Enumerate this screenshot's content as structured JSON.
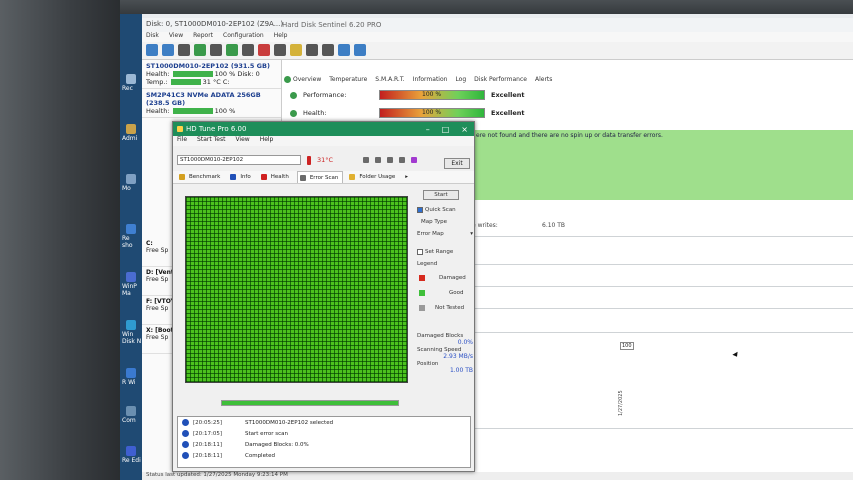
{
  "hds": {
    "title": "Disk: 0, ST1000DM010-2EP102 (Z9A...)",
    "title_center": "Hard Disk Sentinel 6.20 PRO",
    "menu": [
      "Disk",
      "View",
      "Report",
      "Configuration",
      "Help"
    ],
    "disks": [
      {
        "name": "ST1000DM010-2EP102 (931.5 GB)",
        "health_label": "Health:",
        "health": "100 %",
        "disk_label": "Disk: 0",
        "temp_label": "Temp.:",
        "temp": "31 °C",
        "temp_suffix": "C:"
      },
      {
        "name": "SM2P41C3 NVMe ADATA 256GB (238.5 GB)",
        "health_label": "Health:",
        "health": "100 %"
      }
    ],
    "volumes": [
      {
        "name": "C:",
        "free": "Free Sp"
      },
      {
        "name": "D: [Vento",
        "free": "Free Sp"
      },
      {
        "name": "F: [VTOYE",
        "free": "Free Sp"
      },
      {
        "name": "X: [Boot]",
        "free": "Free Sp"
      }
    ],
    "tabs": [
      "Overview",
      "Temperature",
      "S.M.A.R.T.",
      "Information",
      "Log",
      "Disk Performance",
      "Alerts"
    ],
    "performance_label": "Performance:",
    "performance_value": "100 %",
    "performance_rating": "Excellent",
    "health_label": "Health:",
    "health_value": "100 %",
    "health_rating": "Excellent",
    "message": "ere not found and there are no spin up or data transfer errors.",
    "writes_label": "e writes:",
    "writes_value": "6.10 TB",
    "marker": "100",
    "date": "1/27/2025",
    "status": "Status last updated: 1/27/2025 Monday 9:23:14 PM"
  },
  "desktop": [
    "Rec",
    "Admi",
    "Mo",
    "Re sho",
    "WinP Ma",
    "Win Disk N",
    "R Wi",
    "Com",
    "Re Edi"
  ],
  "hdt": {
    "title": "HD Tune Pro 6.00",
    "menu": [
      "File",
      "Start Test",
      "View",
      "Help"
    ],
    "drive": "ST1000DM010-2EP102",
    "temperature": "31°C",
    "exit_label": "Exit",
    "tabs": [
      "Benchmark",
      "Info",
      "Health",
      "Error Scan",
      "Folder Usage"
    ],
    "start_label": "Start",
    "quick_scan": "Quick Scan",
    "map_type": "Map Type",
    "error_map": "Error Map",
    "set_range": "Set Range",
    "legend": "Legend",
    "legend_items": [
      {
        "label": "Damaged",
        "color": "#d62a1e"
      },
      {
        "label": "Good",
        "color": "#3fbf3a"
      },
      {
        "label": "Not Tested",
        "color": "#9a9a9a"
      }
    ],
    "damaged_label": "Damaged Blocks",
    "damaged_value": "0.0%",
    "speed_label": "Scanning Speed",
    "speed_value": "2.93 MB/s",
    "position_label": "Position",
    "position_value": "1.00 TB",
    "log": [
      {
        "time": "[20:05:25]",
        "text": "ST1000DM010-2EP102 selected"
      },
      {
        "time": "[20:17:05]",
        "text": "Start error scan"
      },
      {
        "time": "[20:18:11]",
        "text": "Damaged Blocks: 0.0%"
      },
      {
        "time": "[20:18:11]",
        "text": "Completed"
      }
    ]
  }
}
